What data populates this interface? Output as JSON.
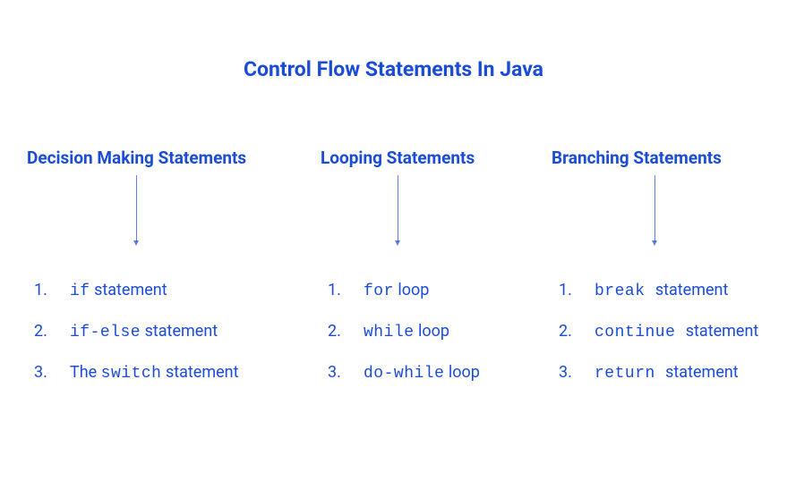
{
  "title": "Control Flow Statements In Java",
  "columns": [
    {
      "header": "Decision Making Statements",
      "items": [
        {
          "num": "1.",
          "code": "if",
          "suffix": " statement"
        },
        {
          "num": "2.",
          "code": "if-else",
          "suffix": " statement"
        },
        {
          "num": "3.",
          "prefix": "The ",
          "code": "switch",
          "suffix": " statement"
        }
      ]
    },
    {
      "header": "Looping Statements",
      "items": [
        {
          "num": "1.",
          "code": "for",
          "suffix": " loop"
        },
        {
          "num": "2.",
          "code": "while",
          "suffix": " loop"
        },
        {
          "num": "3.",
          "code": "do-while",
          "suffix": " loop"
        }
      ]
    },
    {
      "header": "Branching Statements",
      "items": [
        {
          "num": "1.",
          "code": "break ",
          "suffix": " statement"
        },
        {
          "num": "2.",
          "code": "continue ",
          "suffix": " statement"
        },
        {
          "num": "3.",
          "code": "return ",
          "suffix": " statement"
        }
      ]
    }
  ]
}
